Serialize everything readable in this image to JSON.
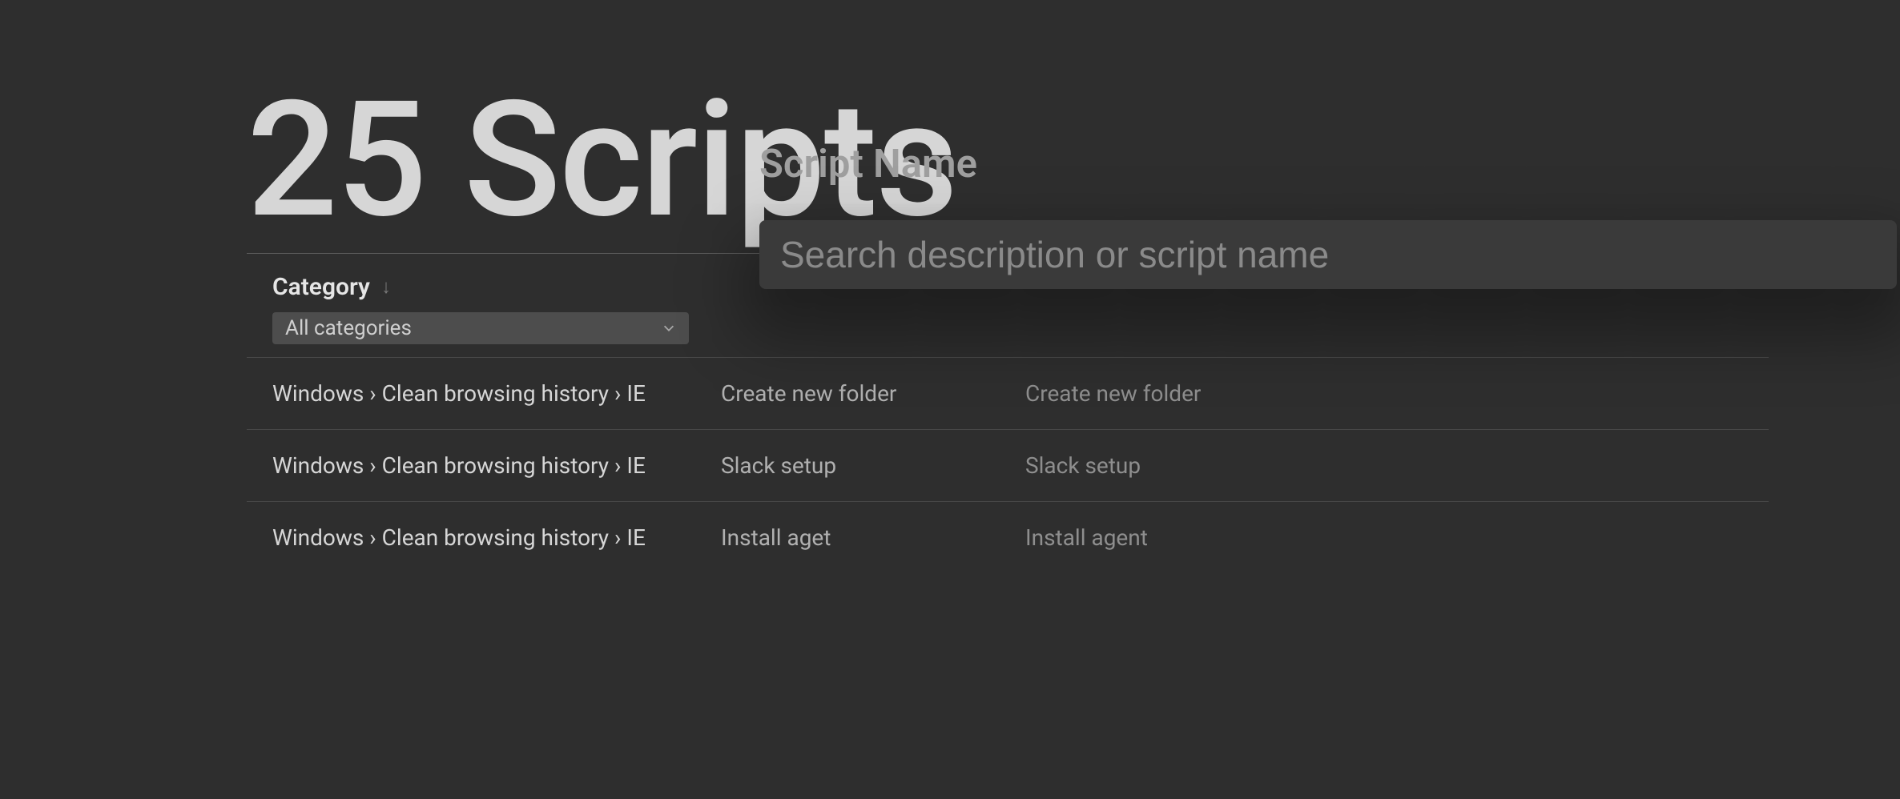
{
  "header": {
    "title": "25 Scripts"
  },
  "filter": {
    "category_label": "Category",
    "sort_indicator": "↓",
    "category_selected": "All categories"
  },
  "search": {
    "label": "Script Name",
    "placeholder": "Search description or script name"
  },
  "rows": [
    {
      "category": "Windows › Clean browsing history › IE",
      "name1": "Create  new folder",
      "name2": "Create new folder"
    },
    {
      "category": "Windows › Clean browsing history › IE",
      "name1": "Slack setup",
      "name2": "Slack setup"
    },
    {
      "category": "Windows › Clean browsing history › IE",
      "name1": "Install aget",
      "name2": "Install agent"
    }
  ]
}
